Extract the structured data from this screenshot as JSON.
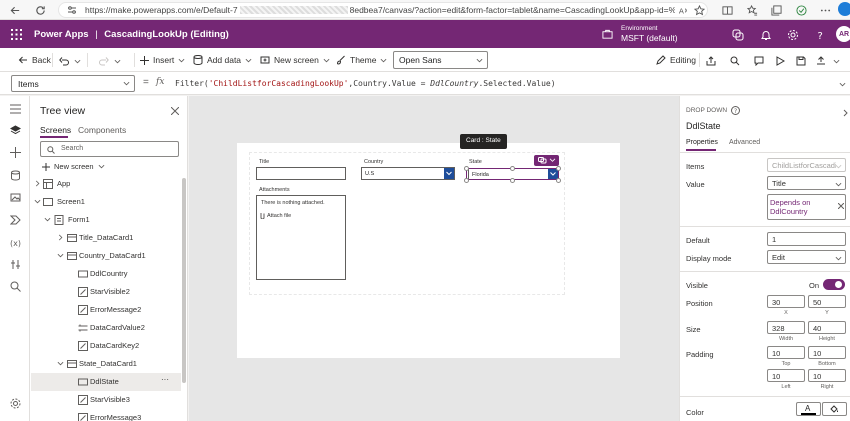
{
  "browser": {
    "url": "https://make.powerapps.com/e/Default-7",
    "url_tail": "8edbea7/canvas/?action=edit&form-factor=tablet&name=CascadingLookUp&app-id=%2F..."
  },
  "header": {
    "brand": "Power Apps",
    "separator": "|",
    "app_name": "CascadingLookUp (Editing)",
    "env_label": "Environment",
    "env_name": "MSFT (default)",
    "avatar": "AR",
    "accent": "#742774"
  },
  "command": {
    "back": "Back",
    "insert": "Insert",
    "add_data": "Add data",
    "new_screen": "New screen",
    "theme": "Theme",
    "font": "Open Sans",
    "editing": "Editing"
  },
  "formula": {
    "property": "Items",
    "fx": "fx",
    "p1": "Filter(",
    "p2": "'ChildListforCascadingLookUp'",
    "p3": ",Country.Value = ",
    "p4": "DdlCountry",
    "p5": ".Selected.Value)"
  },
  "tree": {
    "title": "Tree view",
    "tab_screens": "Screens",
    "tab_components": "Components",
    "search_placeholder": "Search",
    "new_screen": "New screen",
    "nodes": [
      {
        "label": "App"
      },
      {
        "label": "Screen1"
      },
      {
        "label": "Form1"
      },
      {
        "label": "Title_DataCard1"
      },
      {
        "label": "Country_DataCard1"
      },
      {
        "label": "DdlCountry"
      },
      {
        "label": "StarVisible2"
      },
      {
        "label": "ErrorMessage2"
      },
      {
        "label": "DataCardValue2"
      },
      {
        "label": "DataCardKey2"
      },
      {
        "label": "State_DataCard1"
      },
      {
        "label": "DdlState"
      },
      {
        "label": "StarVisible3"
      },
      {
        "label": "ErrorMessage3"
      }
    ],
    "more": "···"
  },
  "canvas": {
    "title_label": "Title",
    "country_label": "Country",
    "country_value": "U.S",
    "state_label": "State",
    "state_value": "Florida",
    "attachments_label": "Attachments",
    "attach_empty": "There is nothing attached.",
    "attach_file": "Attach file",
    "card_tag": "Card : State"
  },
  "properties": {
    "type": "DROP DOWN",
    "name": "DdlState",
    "tab_properties": "Properties",
    "tab_advanced": "Advanced",
    "items_label": "Items",
    "items_value": "ChildListforCascadi...",
    "value_label": "Value",
    "value_value": "Title",
    "depends_on": "Depends on",
    "depends_ctrl": "DdlCountry",
    "default_label": "Default",
    "default_value": "1",
    "display_mode_label": "Display mode",
    "display_mode_value": "Edit",
    "visible_label": "Visible",
    "visible_value": "On",
    "position_label": "Position",
    "pos_x": "30",
    "pos_y": "50",
    "x_label": "X",
    "y_label": "Y",
    "size_label": "Size",
    "width": "328",
    "height": "40",
    "width_label": "Width",
    "height_label": "Height",
    "padding_label": "Padding",
    "pad_top": "10",
    "pad_bottom": "10",
    "pad_left": "10",
    "pad_right": "10",
    "top_label": "Top",
    "bottom_label": "Bottom",
    "left_label": "Left",
    "right_label": "Right",
    "color_label": "Color"
  }
}
